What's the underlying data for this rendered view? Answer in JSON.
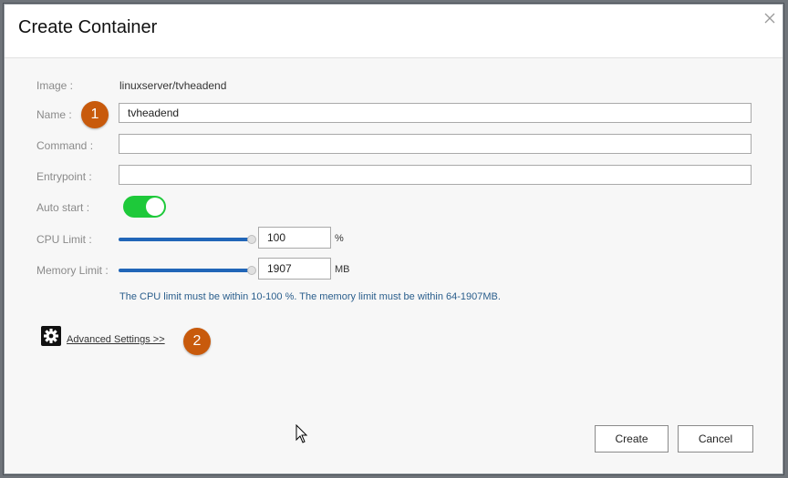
{
  "dialog": {
    "title": "Create Container",
    "close_label": "×"
  },
  "form": {
    "image": {
      "label": "Image :",
      "value": "linuxserver/tvheadend"
    },
    "name": {
      "label": "Name :",
      "value": "tvheadend",
      "badge": "1"
    },
    "command": {
      "label": "Command :",
      "value": ""
    },
    "entrypoint": {
      "label": "Entrypoint :",
      "value": ""
    },
    "auto_start": {
      "label": "Auto start :",
      "on": true
    },
    "cpu_limit": {
      "label": "CPU Limit :",
      "value": "100",
      "unit": "%",
      "level_percent": 100
    },
    "memory_limit": {
      "label": "Memory Limit :",
      "value": "1907",
      "unit": "MB",
      "level_percent": 100
    },
    "hint": "The CPU limit must be within 10-100 %. The memory limit must be within 64-1907MB."
  },
  "advanced": {
    "label": "Advanced Settings >>",
    "badge": "2"
  },
  "buttons": {
    "create": "Create",
    "cancel": "Cancel"
  },
  "colors": {
    "toggle_on": "#1ec93a",
    "slider": "#2166b8",
    "badge": "#c85a0c",
    "hint_text": "#2a5e8c"
  }
}
